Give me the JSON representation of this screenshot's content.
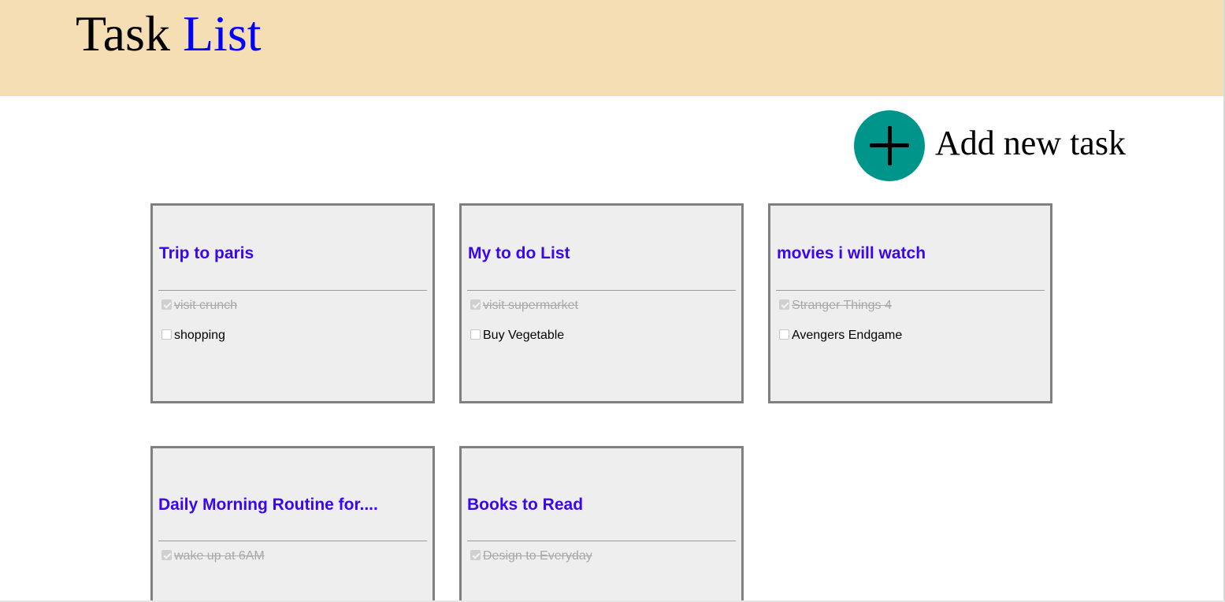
{
  "header": {
    "title_part1": "Task",
    "title_part2": "List",
    "background_color": "#f5deb3",
    "accent_color": "#0000ff"
  },
  "add_task": {
    "label": "Add new task",
    "icon": "plus-icon",
    "button_color": "#00958a"
  },
  "title_color": "#3a06ef",
  "cards": [
    {
      "title": "Trip to paris",
      "tasks": [
        {
          "text": "visit crunch",
          "done": true
        },
        {
          "text": "shopping",
          "done": false
        }
      ]
    },
    {
      "title": "My to do List",
      "tasks": [
        {
          "text": "visit supermarket",
          "done": true
        },
        {
          "text": "Buy Vegetable",
          "done": false
        }
      ]
    },
    {
      "title": "movies i will watch",
      "tasks": [
        {
          "text": "Stranger Things 4",
          "done": true
        },
        {
          "text": "Avengers Endgame",
          "done": false
        }
      ]
    },
    {
      "title": "Daily Morning Routine for....",
      "tasks": [
        {
          "text": "wake up at 6AM",
          "done": true
        }
      ]
    },
    {
      "title": "Books to Read",
      "tasks": [
        {
          "text": "Design to Everyday",
          "done": true
        }
      ]
    }
  ]
}
